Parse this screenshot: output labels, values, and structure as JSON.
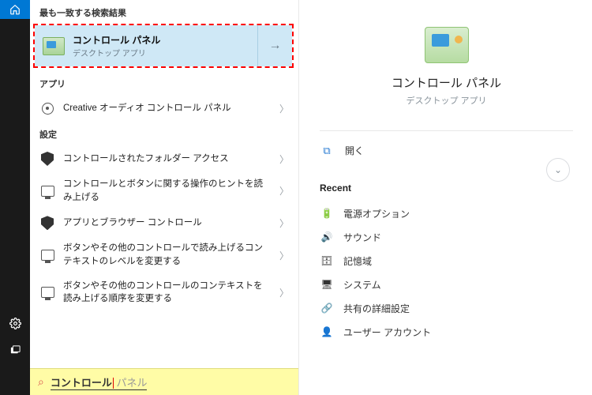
{
  "sections": {
    "best_match_header": "最も一致する検索結果",
    "apps_header": "アプリ",
    "settings_header": "設定"
  },
  "best_match": {
    "title": "コントロール パネル",
    "subtitle": "デスクトップ アプリ"
  },
  "apps": [
    {
      "label": "Creative オーディオ コントロール パネル"
    }
  ],
  "settings": [
    {
      "label": "コントロールされたフォルダー アクセス"
    },
    {
      "label": "コントロールとボタンに関する操作のヒントを読み上げる"
    },
    {
      "label": "アプリとブラウザー コントロール"
    },
    {
      "label": "ボタンやその他のコントロールで読み上げるコンテキストのレベルを変更する"
    },
    {
      "label": "ボタンやその他のコントロールのコンテキストを読み上げる順序を変更する"
    }
  ],
  "search": {
    "typed": "コントロール",
    "hint": " パネル"
  },
  "detail": {
    "title": "コントロール パネル",
    "subtitle": "デスクトップ アプリ",
    "open_label": "開く",
    "recent_header": "Recent",
    "recent": [
      {
        "label": "電源オプション"
      },
      {
        "label": "サウンド"
      },
      {
        "label": "記憶域"
      },
      {
        "label": "システム"
      },
      {
        "label": "共有の詳細設定"
      },
      {
        "label": "ユーザー アカウント"
      }
    ]
  }
}
